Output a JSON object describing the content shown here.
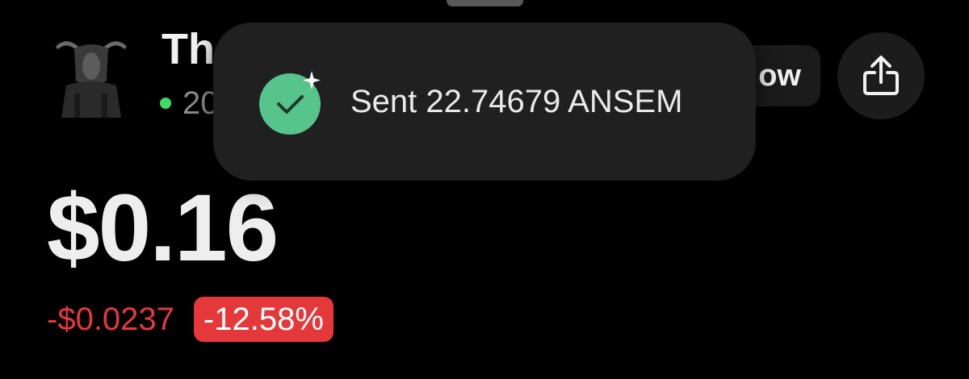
{
  "header": {
    "token_name": "The",
    "holders_count": "20",
    "follow_label": "ow"
  },
  "toast": {
    "message": "Sent 22.74679 ANSEM",
    "icon": "check-circle-icon"
  },
  "price": {
    "current": "$0.16",
    "change_abs": "-$0.0237",
    "change_pct": "-12.58%"
  },
  "colors": {
    "background": "#000000",
    "toast_bg": "#202020",
    "success_green": "#57c48c",
    "online_dot": "#3ddc68",
    "negative_red": "#e5383b"
  },
  "icons": {
    "share": "share-icon",
    "avatar": "bull-avatar"
  }
}
